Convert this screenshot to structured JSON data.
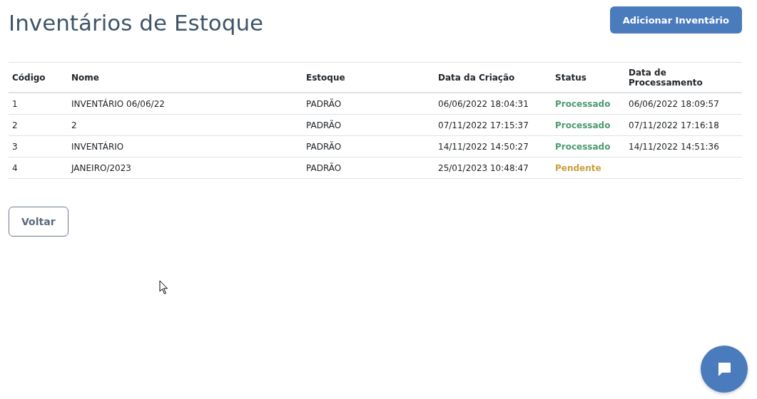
{
  "page": {
    "title": "Inventários de Estoque",
    "add_button": "Adicionar Inventário"
  },
  "table": {
    "columns": [
      "Código",
      "Nome",
      "Estoque",
      "Data da Criação",
      "Status",
      "Data de Processamento"
    ],
    "rows": [
      {
        "code": "1",
        "name": "INVENTÁRIO 06/06/22",
        "stock": "PADRÃO",
        "created": "06/06/2022 18:04:31",
        "status": {
          "text": "Processado",
          "kind": "processed"
        },
        "processed": "06/06/2022 18:09:57"
      },
      {
        "code": "2",
        "name": "2",
        "stock": "PADRÃO",
        "created": "07/11/2022 17:15:37",
        "status": {
          "text": "Processado",
          "kind": "processed"
        },
        "processed": "07/11/2022 17:16:18"
      },
      {
        "code": "3",
        "name": "INVENTÁRIO",
        "stock": "PADRÃO",
        "created": "14/11/2022 14:50:27",
        "status": {
          "text": "Processado",
          "kind": "processed"
        },
        "processed": "14/11/2022 14:51:36"
      },
      {
        "code": "4",
        "name": "JANEIRO/2023",
        "stock": "PADRÃO",
        "created": "25/01/2023 10:48:47",
        "status": {
          "text": "Pendente",
          "kind": "pending"
        }
      }
    ]
  },
  "back_button": "Voltar"
}
